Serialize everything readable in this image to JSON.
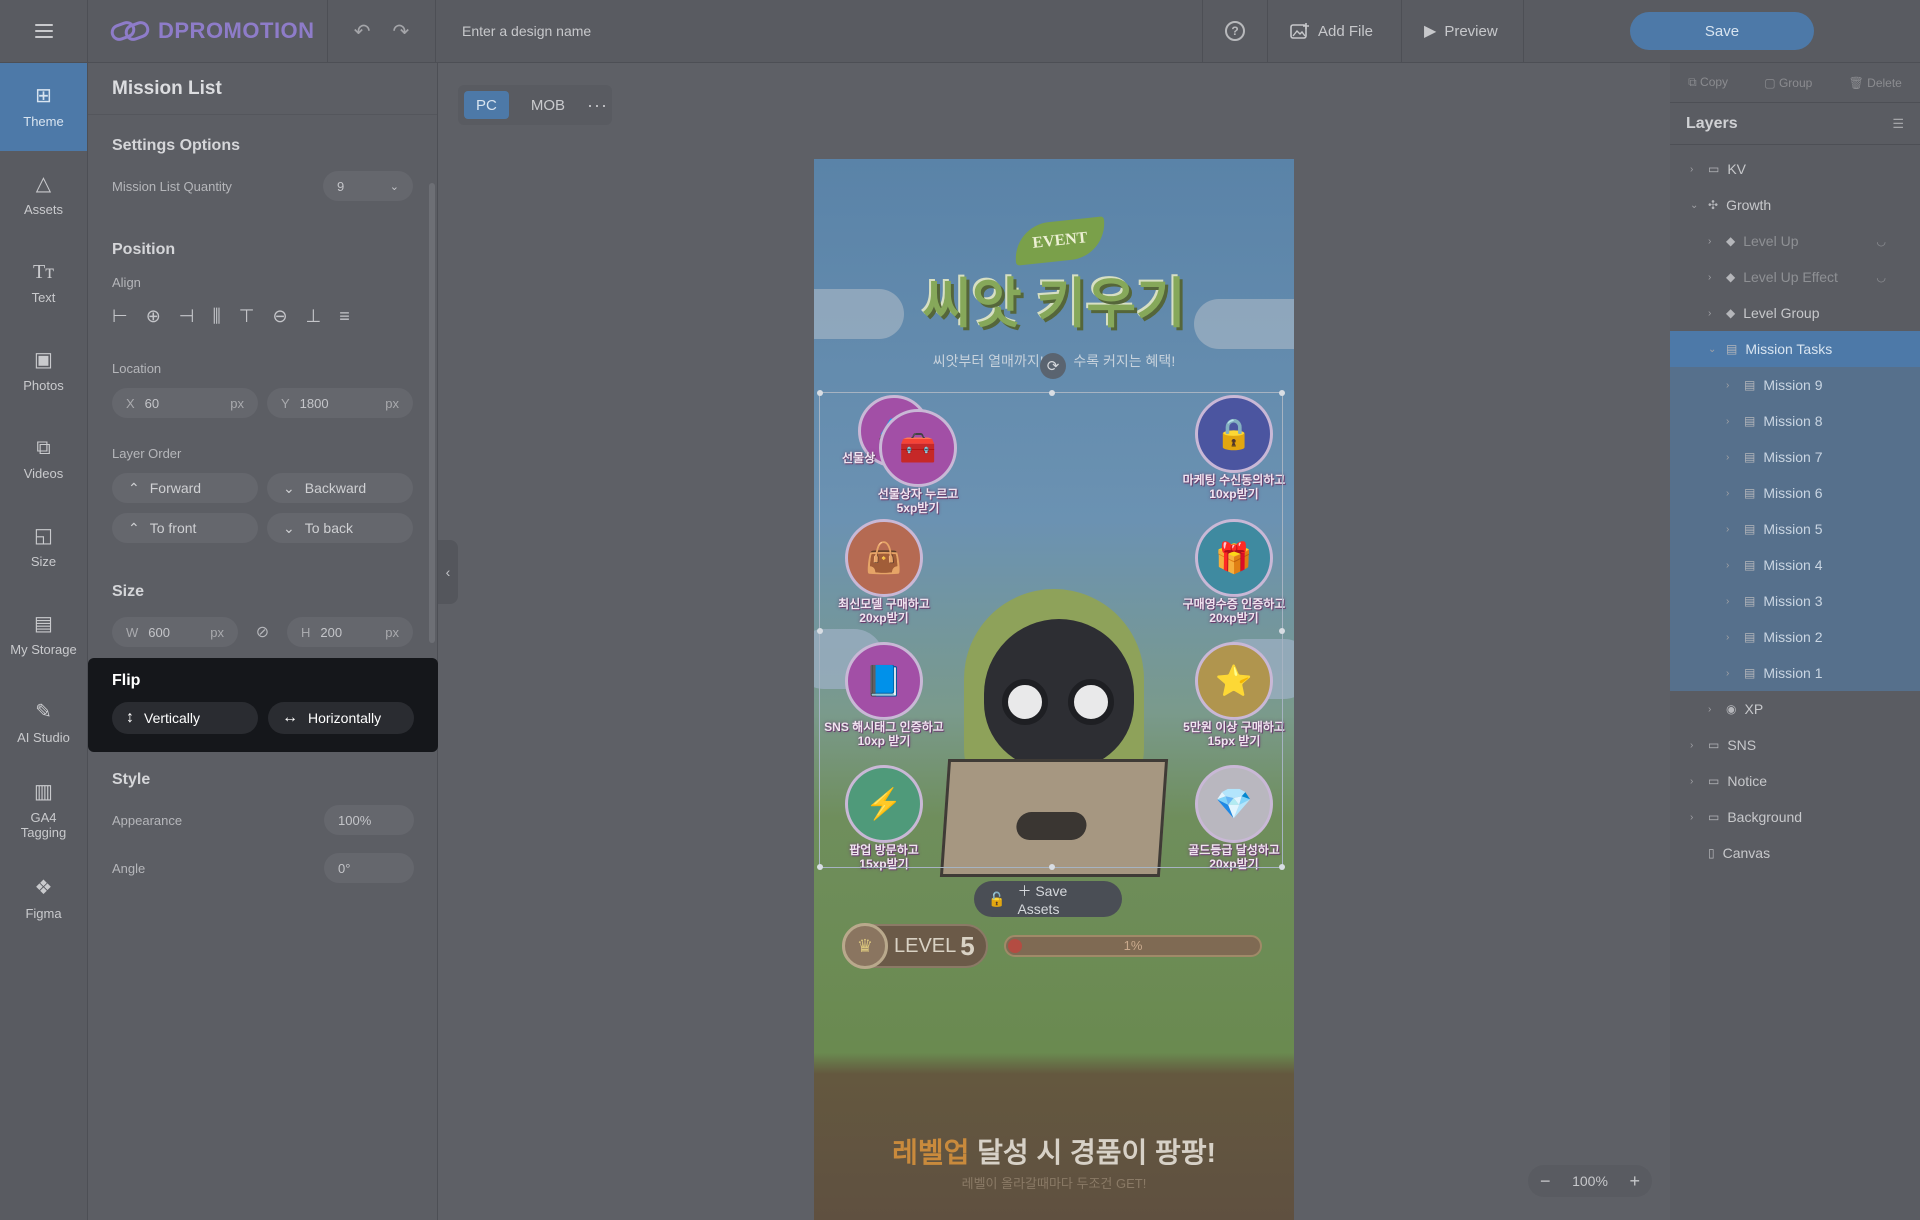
{
  "topbar": {
    "logo": "DPROMOTION",
    "design_name_placeholder": "Enter a design name",
    "help": "?",
    "add_file": "Add File",
    "preview": "Preview",
    "save": "Save"
  },
  "rail": [
    {
      "label": "Theme",
      "icon": "theme-icon",
      "active": true
    },
    {
      "label": "Assets",
      "icon": "shapes-icon"
    },
    {
      "label": "Text",
      "icon": "text-icon"
    },
    {
      "label": "Photos",
      "icon": "photo-icon"
    },
    {
      "label": "Videos",
      "icon": "video-icon"
    },
    {
      "label": "Size",
      "icon": "resize-icon"
    },
    {
      "label": "My Storage",
      "icon": "folder-icon"
    },
    {
      "label": "AI Studio",
      "icon": "magic-wand-icon"
    },
    {
      "label": "GA4 Tagging",
      "icon": "analytics-icon"
    },
    {
      "label": "Figma",
      "icon": "figma-icon"
    }
  ],
  "panel": {
    "title": "Mission List",
    "settings": {
      "heading": "Settings Options",
      "quantity_label": "Mission List Quantity",
      "quantity_value": "9"
    },
    "position": {
      "heading": "Position",
      "align_label": "Align",
      "location_label": "Location",
      "x_label": "X",
      "x_value": "60",
      "x_unit": "px",
      "y_label": "Y",
      "y_value": "1800",
      "y_unit": "px",
      "layer_order_label": "Layer Order",
      "forward": "Forward",
      "backward": "Backward",
      "to_front": "To front",
      "to_back": "To back"
    },
    "size": {
      "heading": "Size",
      "w_label": "W",
      "w_value": "600",
      "h_label": "H",
      "h_value": "200",
      "unit": "px"
    },
    "flip": {
      "heading": "Flip",
      "vertically": "Vertically",
      "horizontally": "Horizontally"
    },
    "style": {
      "heading": "Style",
      "appearance_label": "Appearance",
      "appearance_value": "100%",
      "angle_label": "Angle",
      "angle_value": "0°"
    }
  },
  "canvas": {
    "device_tabs": [
      "PC",
      "MOB"
    ],
    "more": "···",
    "event_badge": "EVENT",
    "title": "씨앗 키우기",
    "subtitle_left": "씨앗부터 열매까지!",
    "subtitle_right": "수록 커지는 혜택!",
    "missions": [
      {
        "label1": "선물상자 누르고",
        "label2": "5xp받기",
        "icon": "chest-icon"
      },
      {
        "label1": "마케팅 수신동의하고",
        "label2": "10xp받기",
        "icon": "lock-icon"
      },
      {
        "label1": "최신모델 구매하고",
        "label2": "20xp받기",
        "icon": "shopping-bag-icon"
      },
      {
        "label1": "구매영수증 인증하고",
        "label2": "20xp받기",
        "icon": "gift-icon"
      },
      {
        "label1": "SNS 해시태그 인증하고",
        "label2": "10xp 받기",
        "icon": "book-icon"
      },
      {
        "label1": "5만원 이상 구매하고",
        "label2": "15px 받기",
        "icon": "star-coin-icon"
      },
      {
        "label1": "팝업 방문하고",
        "label2": "15xp받기",
        "icon": "lightning-icon"
      },
      {
        "label1": "골드등급 달성하고",
        "label2": "20xp받기",
        "icon": "gem-icon"
      }
    ],
    "mission_overlap_label": "선물상",
    "save_assets": "Save Assets",
    "level_label": "LEVEL",
    "level_value": "5",
    "progress_text": "1%",
    "progress": 0.01,
    "bottom_title_hl": "레벨업",
    "bottom_title_rest": " 달성 시 경품이 팡팡!",
    "bottom_sub": "레벨이 올라갈때마다 두조건 GET!",
    "zoom": "100%"
  },
  "layers": {
    "actions": [
      "Copy",
      "Group",
      "Delete"
    ],
    "heading": "Layers",
    "items": [
      {
        "label": "KV",
        "indent": 0,
        "type": "folder"
      },
      {
        "label": "Growth",
        "indent": 0,
        "type": "component",
        "expanded": true
      },
      {
        "label": "Level Up",
        "indent": 1,
        "type": "element",
        "hidden": true
      },
      {
        "label": "Level Up Effect",
        "indent": 1,
        "type": "element",
        "hidden": true
      },
      {
        "label": "Level Group",
        "indent": 1,
        "type": "element"
      },
      {
        "label": "Mission Tasks",
        "indent": 1,
        "type": "list",
        "selected": true
      },
      {
        "label": "Mission 9",
        "indent": 2,
        "type": "list",
        "child": true
      },
      {
        "label": "Mission 8",
        "indent": 2,
        "type": "list",
        "child": true
      },
      {
        "label": "Mission 7",
        "indent": 2,
        "type": "list",
        "child": true
      },
      {
        "label": "Mission 6",
        "indent": 2,
        "type": "list",
        "child": true
      },
      {
        "label": "Mission 5",
        "indent": 2,
        "type": "list",
        "child": true
      },
      {
        "label": "Mission 4",
        "indent": 2,
        "type": "list",
        "child": true
      },
      {
        "label": "Mission 3",
        "indent": 2,
        "type": "list",
        "child": true
      },
      {
        "label": "Mission 2",
        "indent": 2,
        "type": "list",
        "child": true
      },
      {
        "label": "Mission 1",
        "indent": 2,
        "type": "list",
        "child": true
      },
      {
        "label": "XP",
        "indent": 1,
        "type": "xp"
      },
      {
        "label": "SNS",
        "indent": 0,
        "type": "folder"
      },
      {
        "label": "Notice",
        "indent": 0,
        "type": "folder"
      },
      {
        "label": "Background",
        "indent": 0,
        "type": "folder"
      },
      {
        "label": "Canvas",
        "indent": 0,
        "type": "canvas"
      }
    ]
  }
}
